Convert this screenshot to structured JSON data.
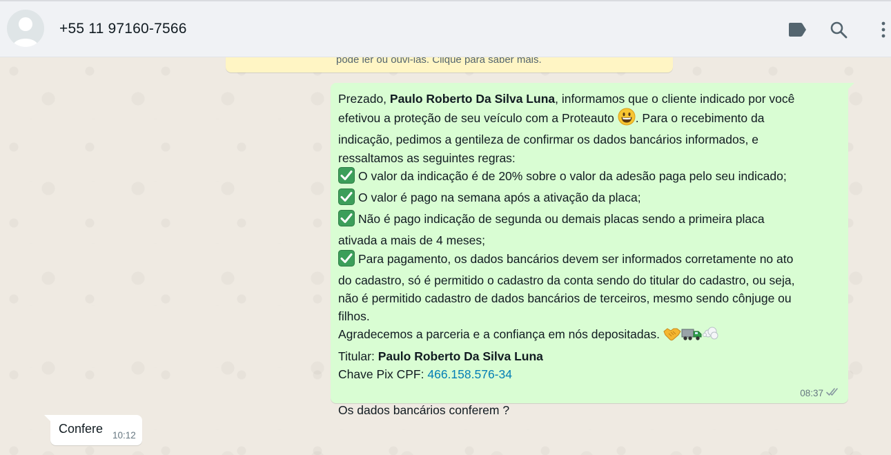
{
  "header": {
    "contact_name": "+55 11 97160-7566",
    "icons": [
      "default-avatar-icon",
      "label-icon",
      "search-icon",
      "menu-icon"
    ]
  },
  "encryption_notice": {
    "text": "pode ler ou ouvi-las. Clique para saber mais."
  },
  "outgoing_message": {
    "greeting": "Prezado, ",
    "recipient_name": "Paulo Roberto Da Silva Luna",
    "line1_rest": ", informamos que o cliente indicado por você",
    "line2a": "efetivou a proteção de seu veículo com a Proteauto ",
    "line2b": ". Para o recebimento da",
    "line3": "indicação, pedimos a gentileza de confirmar os dados bancários informados, e",
    "line4": "ressaltamos as seguintes regras:",
    "rules": [
      "O valor da indicação é de 20% sobre o valor da adesão paga pelo seu indicado;",
      "O valor é pago na semana após a ativação da placa;",
      "Não é pago indicação de segunda ou demais placas sendo a primeira placa",
      "Para pagamento, os dados bancários devem ser informados corretamente no ato"
    ],
    "rule3_cont": "ativada a mais de 4 meses;",
    "rule4_cont": [
      "do cadastro, só é permitido o cadastro da conta sendo do titular do cadastro, ou seja,",
      "não é permitido cadastro de dados bancários de terceiros, mesmo sendo cônjuge ou",
      "filhos."
    ],
    "thanks": "Agradecemos a parceria e a confiança em nós depositadas. ",
    "holder_label": "Titular: ",
    "holder_name": "Paulo Roberto Da Silva Luna",
    "pix_label": "Chave Pix CPF: ",
    "pix_value": "466.158.576-34",
    "question": "Os dados bancários conferem ?",
    "time": "08:37",
    "status": "read"
  },
  "incoming_message": {
    "text": "Confere",
    "time": "10:12"
  },
  "colors": {
    "header_bg": "#f0f2f5",
    "chat_bg": "#efeae2",
    "outgoing_bubble": "#d9fdd3",
    "incoming_bubble": "#ffffff",
    "notice_bg": "#fff5c4",
    "link": "#027eb5",
    "read_ticks": "#8696a0"
  }
}
